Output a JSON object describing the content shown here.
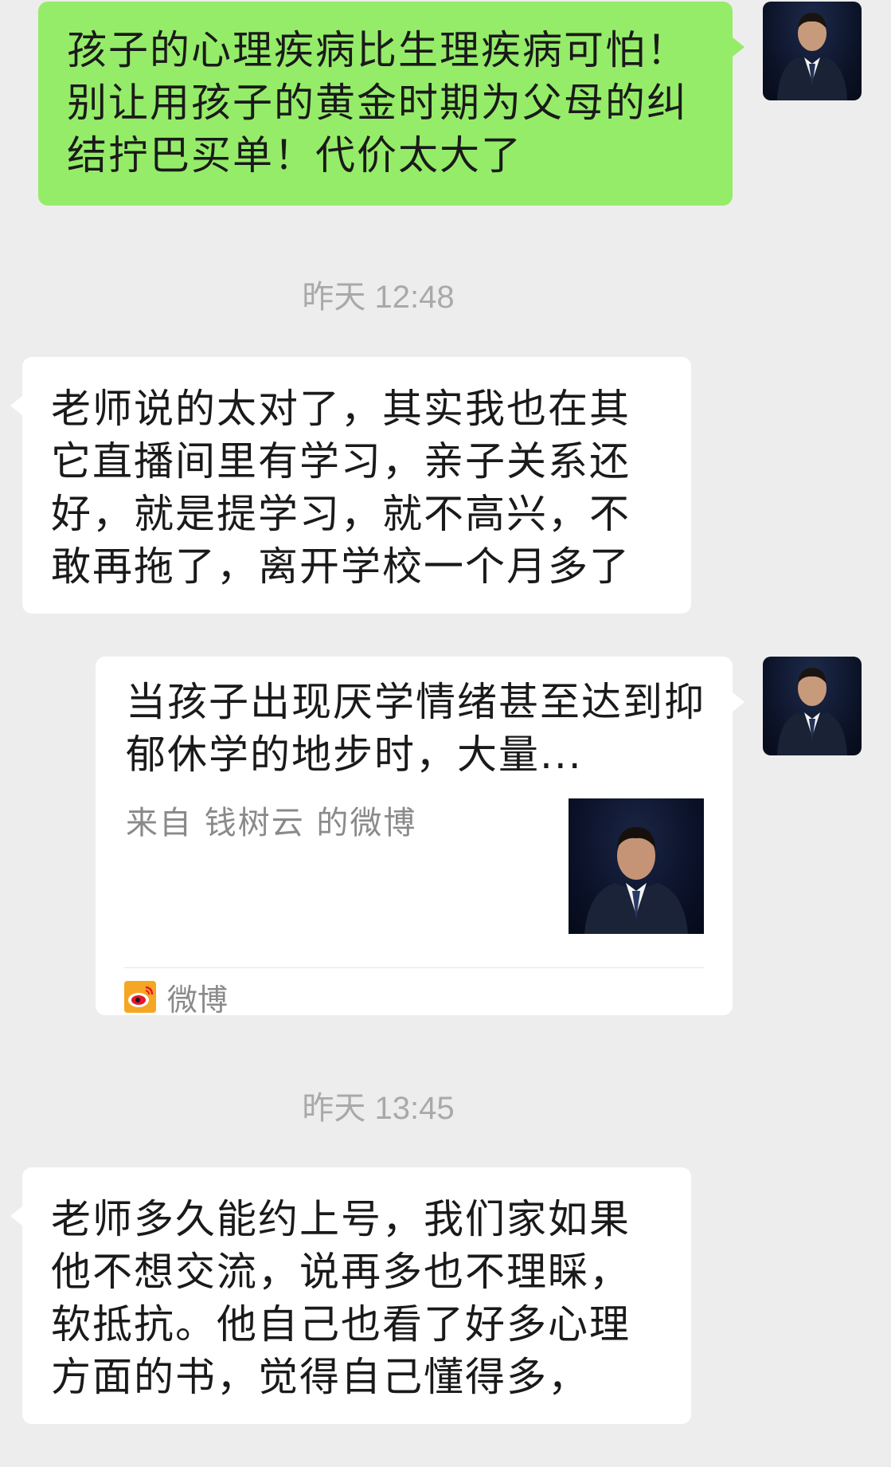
{
  "messages": [
    {
      "type": "sent",
      "text": "孩子的心理疾病比生理疾病可怕！别让用孩子的黄金时期为父母的纠结拧巴买单！代价太大了"
    },
    {
      "type": "timestamp",
      "text": "昨天 12:48"
    },
    {
      "type": "received",
      "text": "老师说的太对了，其实我也在其它直播间里有学习，亲子关系还好，就是提学习，就不高兴，不敢再拖了，离开学校一个月多了"
    },
    {
      "type": "sent-card",
      "title": "当孩子出现厌学情绪甚至达到抑郁休学的地步时，大量...",
      "source": "来自 钱树云 的微博",
      "app_name": "微博"
    },
    {
      "type": "timestamp",
      "text": "昨天 13:45"
    },
    {
      "type": "received",
      "text": "老师多久能约上号，我们家如果他不想交流，说再多也不理睬，软抵抗。他自己也看了好多心理方面的书，觉得自己懂得多，"
    }
  ],
  "colors": {
    "background": "#ededed",
    "sent_bubble": "#95ec69",
    "received_bubble": "#ffffff",
    "timestamp_text": "#a9a9a9",
    "weibo_brand": "#e6162d"
  },
  "icons": {
    "avatar": "user-avatar-photo",
    "card_thumbnail": "article-thumbnail-photo",
    "weibo": "weibo-logo-icon"
  }
}
